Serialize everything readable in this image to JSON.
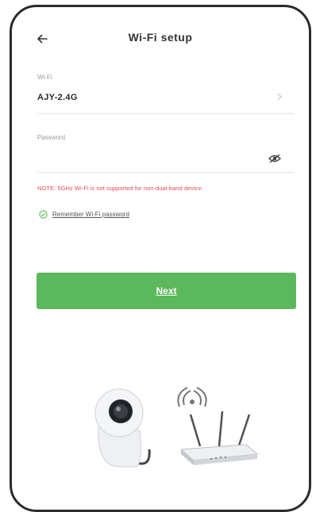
{
  "header": {
    "title": "Wi-Fi setup",
    "back_icon": "arrow-left-icon"
  },
  "wifi": {
    "label": "Wi-Fi",
    "value": "AJY-2.4G",
    "chevron_icon": "chevron-right-icon"
  },
  "password": {
    "label": "Password",
    "value": "",
    "eye_icon": "eye-off-icon"
  },
  "note": "NOTE: 5GHz Wi-Fi is not supported for non-dual-band device.",
  "remember": {
    "label": "Remember Wi-Fi password",
    "checked": true,
    "icon": "check-circle-icon"
  },
  "next_label": "Next",
  "colors": {
    "accent": "#5cb85c",
    "note": "#e0505a"
  }
}
